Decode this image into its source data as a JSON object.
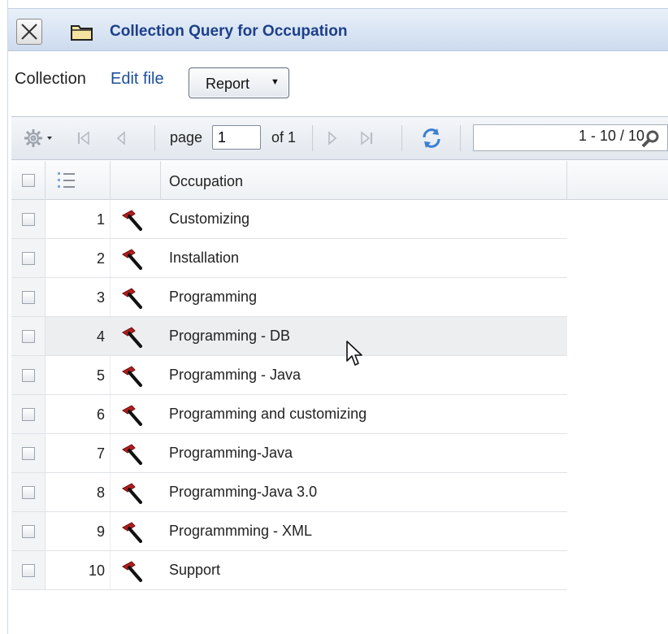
{
  "window": {
    "title": "Collection Query for Occupation",
    "close_icon": "close-icon",
    "folder_icon": "folder-icon"
  },
  "actions": {
    "collection_label": "Collection",
    "edit_file_label": "Edit file",
    "report_label": "Report"
  },
  "toolbar": {
    "page_label": "page",
    "page_value": "1",
    "of_label": "of 1",
    "range_label": "1 - 10 / 10",
    "icons": [
      "gear-icon",
      "first-page-icon",
      "prev-page-icon",
      "next-page-icon",
      "last-page-icon",
      "refresh-icon",
      "search-icon"
    ]
  },
  "grid": {
    "column_header": "Occupation",
    "rows": [
      {
        "num": "1",
        "label": "Customizing"
      },
      {
        "num": "2",
        "label": "Installation"
      },
      {
        "num": "3",
        "label": "Programming"
      },
      {
        "num": "4",
        "label": "Programming - DB"
      },
      {
        "num": "5",
        "label": "Programming - Java"
      },
      {
        "num": "6",
        "label": "Programming and customizing"
      },
      {
        "num": "7",
        "label": "Programming-Java"
      },
      {
        "num": "8",
        "label": "Programming-Java 3.0"
      },
      {
        "num": "9",
        "label": "Programmming - XML"
      },
      {
        "num": "10",
        "label": "Support"
      }
    ],
    "hovered_row": 3,
    "row_icon": "hammer-icon"
  },
  "colors": {
    "title_text": "#1d3f8a",
    "link": "#1d4f9c",
    "hammer": "#9b1c1c"
  }
}
